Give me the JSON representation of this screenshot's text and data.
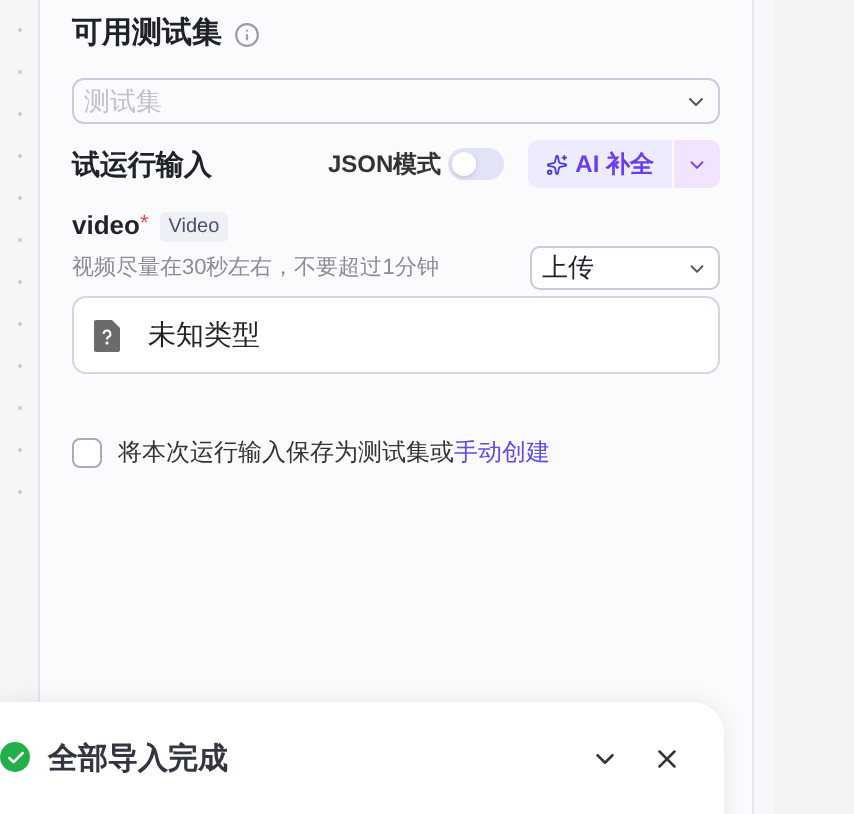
{
  "section_title": "可用测试集",
  "testset_select": {
    "placeholder": "测试集"
  },
  "run_input": {
    "title": "试运行输入",
    "json_mode": {
      "label": "JSON模式",
      "on": false
    },
    "ai_button": "AI 补全"
  },
  "field": {
    "name": "video",
    "required_mark": "*",
    "type_tag": "Video",
    "hint": "视频尽量在30秒左右，不要超过1分钟",
    "source_select": "上传",
    "file_label": "未知类型"
  },
  "save_option": {
    "checked": false,
    "text": "将本次运行输入保存为测试集或",
    "link": "手动创建"
  },
  "toast": {
    "message": "全部导入完成"
  }
}
